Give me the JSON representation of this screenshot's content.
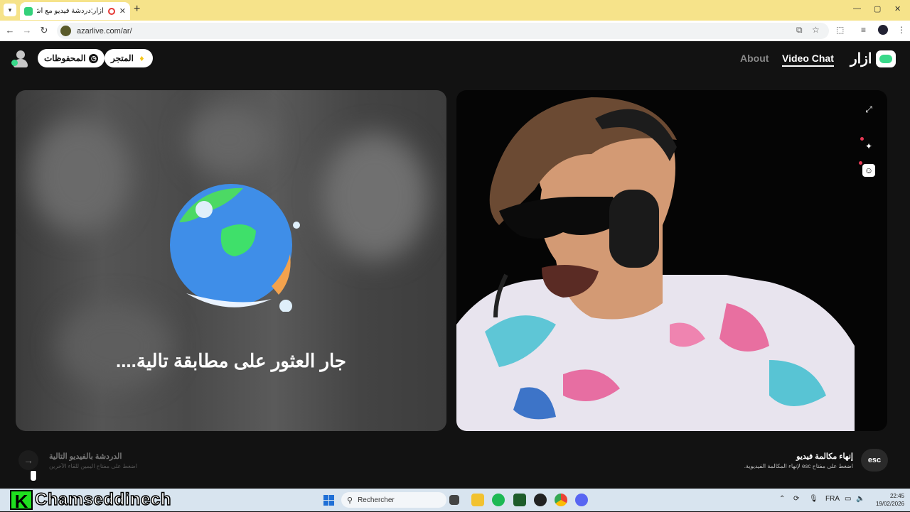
{
  "browser": {
    "tab_title": "أزار:دردشة فيديو مع أشخاص",
    "tab_close": "✕",
    "new_tab": "+",
    "url": "azarlive.com/ar/",
    "window_controls": [
      "—",
      "▢",
      "✕"
    ]
  },
  "header": {
    "logo_text": "ازار",
    "nav": {
      "video_chat": "Video Chat",
      "about": "About"
    },
    "shop_label": "المتجر",
    "saved_label": "المحفوظات"
  },
  "left_panel": {
    "status_text": "جار العثور على مطابقة تالية...."
  },
  "footer": {
    "next_title": "الدردشة بالفيديو التالية",
    "next_subtitle": "اضغط على مفتاح اليمين للقاء الآخرين",
    "next_arrow": "→",
    "end_title": "إنهاء مكالمة فيديو",
    "end_subtitle": "اضغط على مفتاح esc لإنهاء المكالمة الفيديوية.",
    "esc_label": "esc"
  },
  "watermark": {
    "letter": "K",
    "name": "Chamseddinech"
  },
  "taskbar": {
    "search_placeholder": "Rechercher",
    "language": "FRA",
    "time": "22:45",
    "date": "19/02/2026"
  },
  "colors": {
    "brand_green": "#39d98a",
    "page_bg": "#121212",
    "chrome_yellow": "#f6e38a"
  },
  "icons": [
    "search-icon",
    "expand-icon",
    "magic-wand-icon",
    "face-icon",
    "clock-icon",
    "diamond-icon",
    "arrow-right-icon"
  ]
}
